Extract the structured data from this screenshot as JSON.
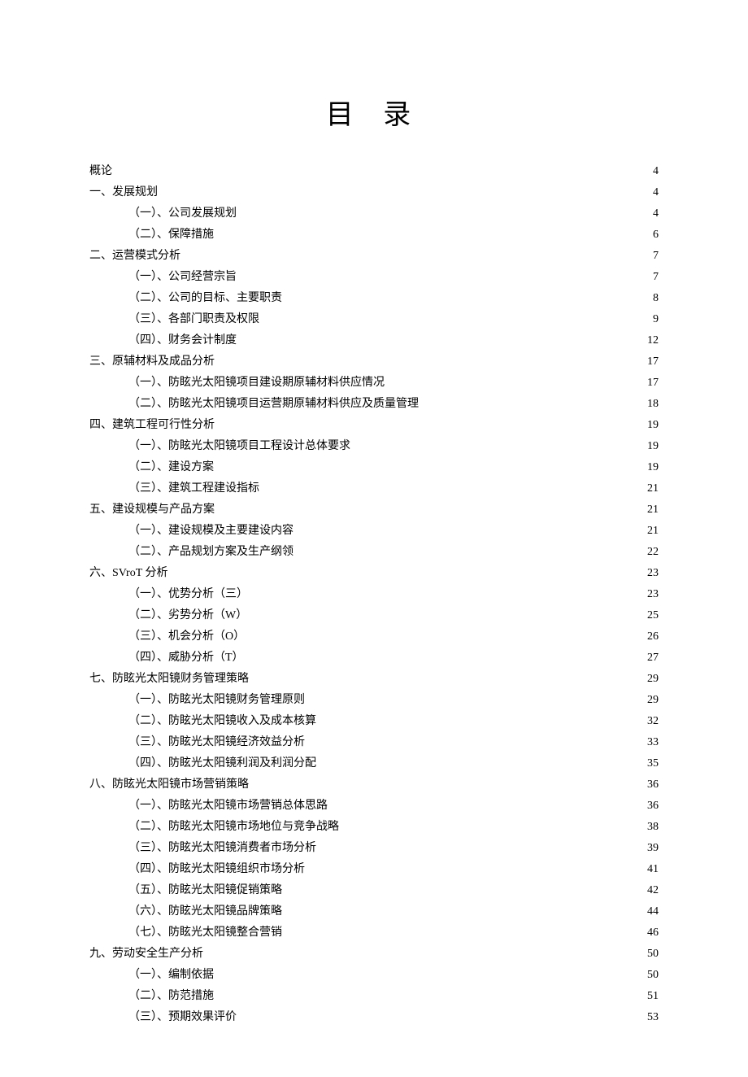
{
  "title": "目 录",
  "toc": [
    {
      "level": 0,
      "label": "概论",
      "page": "4"
    },
    {
      "level": 0,
      "label": "一、发展规划",
      "page": "4"
    },
    {
      "level": 1,
      "label": "（一）、公司发展规划",
      "page": "4"
    },
    {
      "level": 1,
      "label": "（二）、保障措施",
      "page": "6"
    },
    {
      "level": 0,
      "label": "二、运营模式分析",
      "page": "7"
    },
    {
      "level": 1,
      "label": "（一）、公司经营宗旨",
      "page": "7"
    },
    {
      "level": 1,
      "label": "（二）、公司的目标、主要职责",
      "page": "8"
    },
    {
      "level": 1,
      "label": "（三）、各部门职责及权限",
      "page": "9"
    },
    {
      "level": 1,
      "label": "（四）、财务会计制度",
      "page": "12"
    },
    {
      "level": 0,
      "label": "三、原辅材料及成品分析",
      "page": "17"
    },
    {
      "level": 1,
      "label": "（一）、防眩光太阳镜项目建设期原辅材料供应情况",
      "page": "17"
    },
    {
      "level": 1,
      "label": "（二）、防眩光太阳镜项目运营期原辅材料供应及质量管理",
      "page": "18"
    },
    {
      "level": 0,
      "label": "四、建筑工程可行性分析",
      "page": "19"
    },
    {
      "level": 1,
      "label": "（一）、防眩光太阳镜项目工程设计总体要求",
      "page": "19"
    },
    {
      "level": 1,
      "label": "（二）、建设方案",
      "page": "19"
    },
    {
      "level": 1,
      "label": "（三）、建筑工程建设指标",
      "page": "21"
    },
    {
      "level": 0,
      "label": "五、建设规模与产品方案",
      "page": "21"
    },
    {
      "level": 1,
      "label": "（一）、建设规模及主要建设内容",
      "page": "21"
    },
    {
      "level": 1,
      "label": "（二）、产品规划方案及生产纲领",
      "page": "22"
    },
    {
      "level": 0,
      "label": "六、SVroT 分析",
      "page": "23"
    },
    {
      "level": 1,
      "label": "（一）、优势分析（三）",
      "page": "23"
    },
    {
      "level": 1,
      "label": "（二）、劣势分析（W）",
      "page": "25"
    },
    {
      "level": 1,
      "label": "（三）、机会分析（O）",
      "page": "26"
    },
    {
      "level": 1,
      "label": "（四）、威胁分析（T）",
      "page": "27"
    },
    {
      "level": 0,
      "label": "七、防眩光太阳镜财务管理策略",
      "page": "29"
    },
    {
      "level": 1,
      "label": "（一）、防眩光太阳镜财务管理原则",
      "page": "29"
    },
    {
      "level": 1,
      "label": "（二）、防眩光太阳镜收入及成本核算",
      "page": "32"
    },
    {
      "level": 1,
      "label": "（三）、防眩光太阳镜经济效益分析",
      "page": "33"
    },
    {
      "level": 1,
      "label": "（四）、防眩光太阳镜利润及利润分配",
      "page": "35"
    },
    {
      "level": 0,
      "label": "八、防眩光太阳镜市场营销策略",
      "page": "36"
    },
    {
      "level": 1,
      "label": "（一）、防眩光太阳镜市场营销总体思路",
      "page": "36"
    },
    {
      "level": 1,
      "label": "（二）、防眩光太阳镜市场地位与竞争战略",
      "page": "38"
    },
    {
      "level": 1,
      "label": "（三）、防眩光太阳镜消费者市场分析",
      "page": "39"
    },
    {
      "level": 1,
      "label": "（四）、防眩光太阳镜组织市场分析",
      "page": "41"
    },
    {
      "level": 1,
      "label": "（五）、防眩光太阳镜促销策略",
      "page": "42"
    },
    {
      "level": 1,
      "label": "（六）、防眩光太阳镜品牌策略",
      "page": "44"
    },
    {
      "level": 1,
      "label": "（七）、防眩光太阳镜整合营销",
      "page": "46"
    },
    {
      "level": 0,
      "label": "九、劳动安全生产分析",
      "page": "50"
    },
    {
      "level": 1,
      "label": "（一）、编制依据",
      "page": "50"
    },
    {
      "level": 1,
      "label": "（二）、防范措施",
      "page": "51"
    },
    {
      "level": 1,
      "label": "（三）、预期效果评价",
      "page": "53"
    }
  ]
}
